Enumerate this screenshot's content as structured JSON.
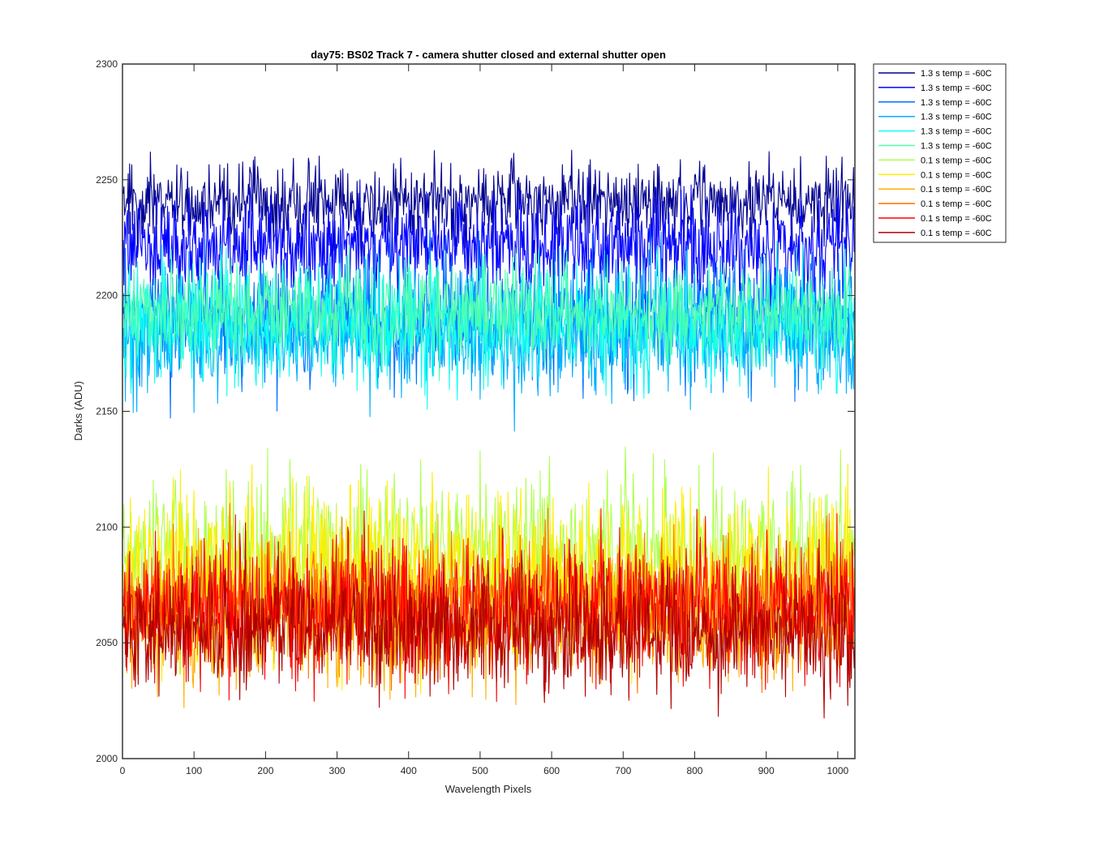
{
  "chart_data": {
    "type": "line",
    "title": "day75: BS02  Track 7 - camera shutter closed and external shutter open",
    "xlabel": "Wavelength Pixels",
    "ylabel": "Darks (ADU)",
    "xlim": [
      0,
      1024
    ],
    "ylim": [
      2000,
      2300
    ],
    "xticks": [
      "0",
      "100",
      "200",
      "300",
      "400",
      "500",
      "600",
      "700",
      "800",
      "900",
      "1000"
    ],
    "yticks": [
      "2000",
      "2050",
      "2100",
      "2150",
      "2200",
      "2250",
      "2300"
    ],
    "grid": false,
    "legend_position": "outside-top-right",
    "x_points": 1024,
    "series": [
      {
        "name": "1.3 s temp = -60C",
        "color": "#00008f",
        "mean": 2240,
        "start": 2244,
        "end": 2232,
        "min": 2205,
        "max": 2264
      },
      {
        "name": "1.3 s temp = -60C",
        "color": "#0000ff",
        "mean": 2222,
        "start": 2224,
        "end": 2222,
        "min": 2190,
        "max": 2252
      },
      {
        "name": "1.3 s temp = -60C",
        "color": "#0070ff",
        "mean": 2190,
        "start": 2192,
        "end": 2188,
        "min": 2146,
        "max": 2230
      },
      {
        "name": "1.3 s temp = -60C",
        "color": "#00afff",
        "mean": 2183,
        "start": 2186,
        "end": 2180,
        "min": 2137,
        "max": 2218
      },
      {
        "name": "1.3 s temp = -60C",
        "color": "#0fffef",
        "mean": 2188,
        "start": 2190,
        "end": 2186,
        "min": 2150,
        "max": 2225
      },
      {
        "name": "1.3 s temp = -60C",
        "color": "#4fffaf",
        "mean": 2193,
        "start": 2195,
        "end": 2193,
        "min": 2146,
        "max": 2222
      },
      {
        "name": "0.1 s temp = -60C",
        "color": "#afff4f",
        "mean": 2088,
        "start": 2095,
        "end": 2080,
        "min": 2021,
        "max": 2135
      },
      {
        "name": "0.1 s temp = -60C",
        "color": "#ffef00",
        "mean": 2080,
        "start": 2084,
        "end": 2075,
        "min": 2028,
        "max": 2135
      },
      {
        "name": "0.1 s temp = -60C",
        "color": "#ffaf00",
        "mean": 2060,
        "start": 2062,
        "end": 2057,
        "min": 2021,
        "max": 2115
      },
      {
        "name": "0.1 s temp = -60C",
        "color": "#ff7000",
        "mean": 2068,
        "start": 2070,
        "end": 2065,
        "min": 2028,
        "max": 2133
      },
      {
        "name": "0.1 s temp = -60C",
        "color": "#ff0000",
        "mean": 2065,
        "start": 2067,
        "end": 2060,
        "min": 2024,
        "max": 2122
      },
      {
        "name": "0.1 s temp = -60C",
        "color": "#af0000",
        "mean": 2055,
        "start": 2057,
        "end": 2052,
        "min": 2017,
        "max": 2110
      }
    ]
  }
}
